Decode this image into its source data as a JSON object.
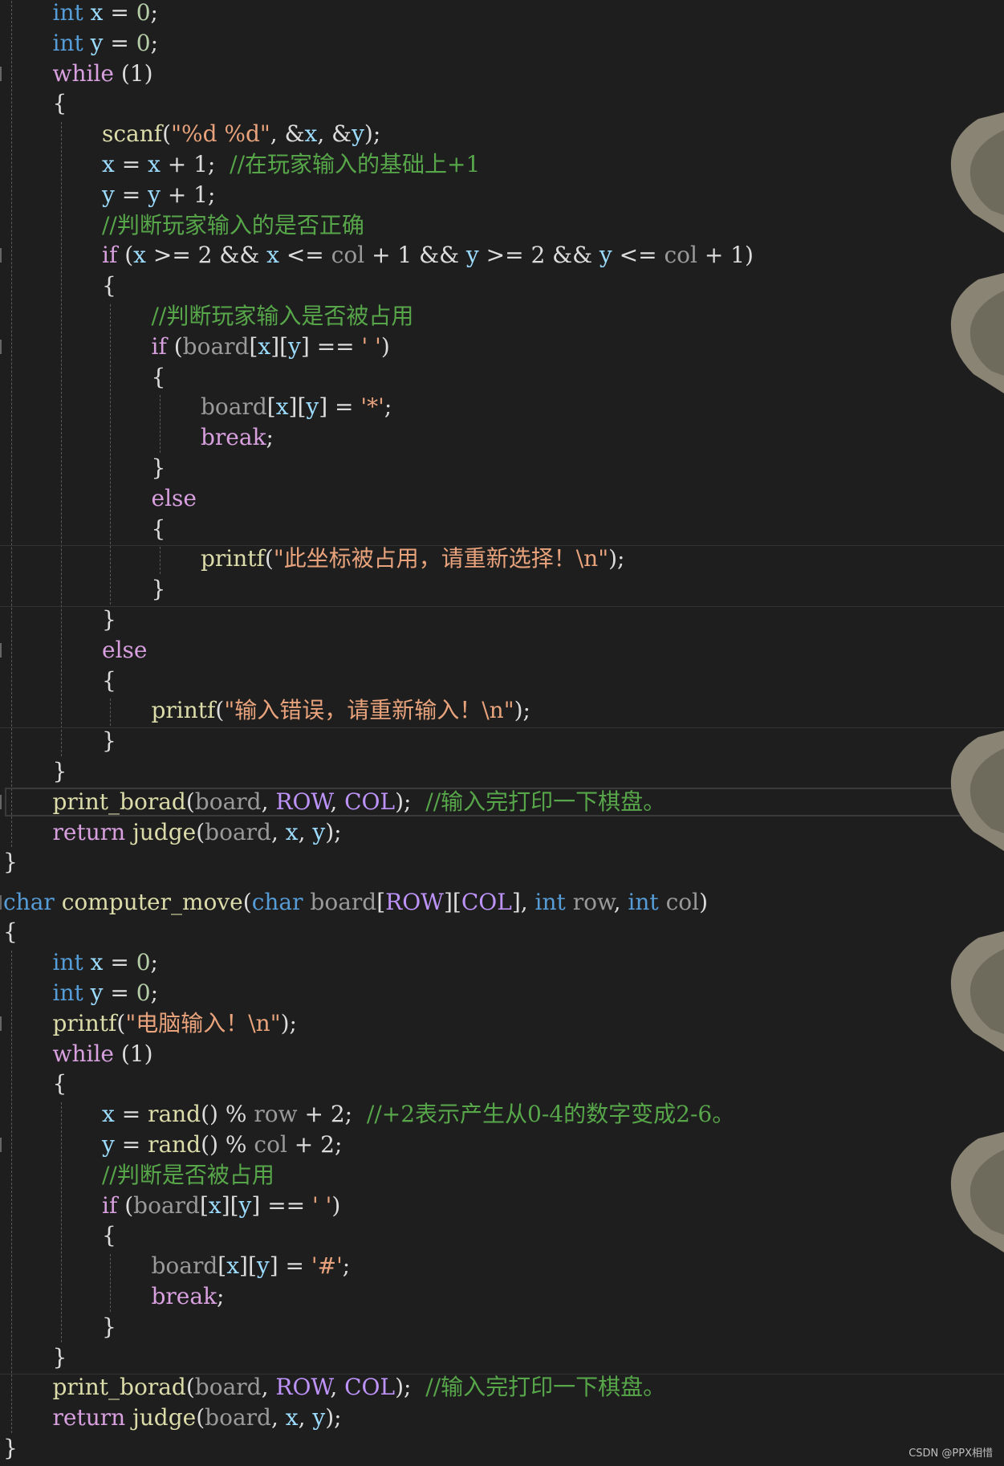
{
  "colors": {
    "background": "#1e1e1e",
    "keyword": "#569cd6",
    "control": "#d8a0df",
    "function": "#dcdcaa",
    "string": "#e8a37c",
    "comment": "#57a64a",
    "param": "#9a9a9a",
    "variable": "#9cdcfe",
    "macro": "#bd93f9",
    "text": "#dcdcdc"
  },
  "code": {
    "lines": [
      {
        "indent": 1,
        "tokens": [
          {
            "t": "int",
            "c": "keyword"
          },
          {
            "t": " "
          },
          {
            "t": "x",
            "c": "variable"
          },
          {
            "t": " = "
          },
          {
            "t": "0",
            "c": "number"
          },
          {
            "t": ";"
          }
        ]
      },
      {
        "indent": 1,
        "tokens": [
          {
            "t": "int",
            "c": "keyword"
          },
          {
            "t": " "
          },
          {
            "t": "y",
            "c": "variable"
          },
          {
            "t": " = "
          },
          {
            "t": "0",
            "c": "number"
          },
          {
            "t": ";"
          }
        ]
      },
      {
        "indent": 1,
        "tokens": [
          {
            "t": "while",
            "c": "control"
          },
          {
            "t": " (1)"
          }
        ]
      },
      {
        "indent": 1,
        "tokens": [
          {
            "t": "{"
          }
        ]
      },
      {
        "indent": 2,
        "tokens": [
          {
            "t": "scanf",
            "c": "function"
          },
          {
            "t": "("
          },
          {
            "t": "\"%d %d\"",
            "c": "string"
          },
          {
            "t": ", &"
          },
          {
            "t": "x",
            "c": "variable"
          },
          {
            "t": ", &"
          },
          {
            "t": "y",
            "c": "variable"
          },
          {
            "t": ");"
          }
        ]
      },
      {
        "indent": 2,
        "tokens": [
          {
            "t": "x",
            "c": "variable"
          },
          {
            "t": " = "
          },
          {
            "t": "x",
            "c": "variable"
          },
          {
            "t": " + 1;  "
          },
          {
            "t": "//在玩家输入的基础上+1",
            "c": "comment"
          }
        ]
      },
      {
        "indent": 2,
        "tokens": [
          {
            "t": "y",
            "c": "variable"
          },
          {
            "t": " = "
          },
          {
            "t": "y",
            "c": "variable"
          },
          {
            "t": " + 1;"
          }
        ]
      },
      {
        "indent": 2,
        "tokens": [
          {
            "t": "//判断玩家输入的是否正确",
            "c": "comment"
          }
        ]
      },
      {
        "indent": 2,
        "tokens": [
          {
            "t": "if",
            "c": "control"
          },
          {
            "t": " ("
          },
          {
            "t": "x",
            "c": "variable"
          },
          {
            "t": " >= 2 && "
          },
          {
            "t": "x",
            "c": "variable"
          },
          {
            "t": " <= "
          },
          {
            "t": "col",
            "c": "param"
          },
          {
            "t": " + 1 && "
          },
          {
            "t": "y",
            "c": "variable"
          },
          {
            "t": " >= 2 && "
          },
          {
            "t": "y",
            "c": "variable"
          },
          {
            "t": " <= "
          },
          {
            "t": "col",
            "c": "param"
          },
          {
            "t": " + 1)"
          }
        ]
      },
      {
        "indent": 2,
        "tokens": [
          {
            "t": "{"
          }
        ]
      },
      {
        "indent": 3,
        "tokens": [
          {
            "t": "//判断玩家输入是否被占用",
            "c": "comment"
          }
        ]
      },
      {
        "indent": 3,
        "tokens": [
          {
            "t": "if",
            "c": "control"
          },
          {
            "t": " ("
          },
          {
            "t": "board",
            "c": "param"
          },
          {
            "t": "["
          },
          {
            "t": "x",
            "c": "variable"
          },
          {
            "t": "]["
          },
          {
            "t": "y",
            "c": "variable"
          },
          {
            "t": "] == "
          },
          {
            "t": "' '",
            "c": "string"
          },
          {
            "t": ")"
          }
        ]
      },
      {
        "indent": 3,
        "tokens": [
          {
            "t": "{"
          }
        ]
      },
      {
        "indent": 4,
        "tokens": [
          {
            "t": "board",
            "c": "param"
          },
          {
            "t": "["
          },
          {
            "t": "x",
            "c": "variable"
          },
          {
            "t": "]["
          },
          {
            "t": "y",
            "c": "variable"
          },
          {
            "t": "] = "
          },
          {
            "t": "'*'",
            "c": "string"
          },
          {
            "t": ";"
          }
        ]
      },
      {
        "indent": 4,
        "tokens": [
          {
            "t": "break",
            "c": "control"
          },
          {
            "t": ";"
          }
        ]
      },
      {
        "indent": 3,
        "tokens": [
          {
            "t": "}"
          }
        ]
      },
      {
        "indent": 3,
        "tokens": [
          {
            "t": "else",
            "c": "control"
          }
        ]
      },
      {
        "indent": 3,
        "tokens": [
          {
            "t": "{"
          }
        ]
      },
      {
        "indent": 4,
        "tokens": [
          {
            "t": "printf",
            "c": "function"
          },
          {
            "t": "("
          },
          {
            "t": "\"此坐标被占用，请重新选择！\\n\"",
            "c": "string"
          },
          {
            "t": ");"
          }
        ]
      },
      {
        "indent": 3,
        "tokens": [
          {
            "t": "}"
          }
        ]
      },
      {
        "indent": 2,
        "tokens": [
          {
            "t": "}"
          }
        ]
      },
      {
        "indent": 2,
        "tokens": [
          {
            "t": "else",
            "c": "control"
          }
        ]
      },
      {
        "indent": 2,
        "tokens": [
          {
            "t": "{"
          }
        ]
      },
      {
        "indent": 3,
        "tokens": [
          {
            "t": "printf",
            "c": "function"
          },
          {
            "t": "("
          },
          {
            "t": "\"输入错误，请重新输入！\\n\"",
            "c": "string"
          },
          {
            "t": ");"
          }
        ]
      },
      {
        "indent": 2,
        "tokens": [
          {
            "t": "}"
          }
        ]
      },
      {
        "indent": 1,
        "tokens": [
          {
            "t": "}"
          }
        ]
      },
      {
        "indent": 1,
        "tokens": [
          {
            "t": "print_borad",
            "c": "function"
          },
          {
            "t": "("
          },
          {
            "t": "board",
            "c": "param"
          },
          {
            "t": ", "
          },
          {
            "t": "ROW",
            "c": "macro"
          },
          {
            "t": ", "
          },
          {
            "t": "COL",
            "c": "macro"
          },
          {
            "t": ");  "
          },
          {
            "t": "//输入完打印一下棋盘。",
            "c": "comment"
          }
        ]
      },
      {
        "indent": 1,
        "tokens": [
          {
            "t": "return",
            "c": "control"
          },
          {
            "t": " "
          },
          {
            "t": "judge",
            "c": "function"
          },
          {
            "t": "("
          },
          {
            "t": "board",
            "c": "param"
          },
          {
            "t": ", "
          },
          {
            "t": "x",
            "c": "variable"
          },
          {
            "t": ", "
          },
          {
            "t": "y",
            "c": "variable"
          },
          {
            "t": ");"
          }
        ]
      },
      {
        "indent": 0,
        "tokens": [
          {
            "t": "}"
          }
        ]
      },
      {
        "indent": 0,
        "tokens": [
          {
            "t": "char",
            "c": "keyword"
          },
          {
            "t": " "
          },
          {
            "t": "computer_move",
            "c": "function"
          },
          {
            "t": "("
          },
          {
            "t": "char",
            "c": "keyword"
          },
          {
            "t": " "
          },
          {
            "t": "board",
            "c": "param"
          },
          {
            "t": "["
          },
          {
            "t": "ROW",
            "c": "macro"
          },
          {
            "t": "]["
          },
          {
            "t": "COL",
            "c": "macro"
          },
          {
            "t": "], "
          },
          {
            "t": "int",
            "c": "keyword"
          },
          {
            "t": " "
          },
          {
            "t": "row",
            "c": "param"
          },
          {
            "t": ", "
          },
          {
            "t": "int",
            "c": "keyword"
          },
          {
            "t": " "
          },
          {
            "t": "col",
            "c": "param"
          },
          {
            "t": ")"
          }
        ]
      },
      {
        "indent": 0,
        "tokens": [
          {
            "t": "{"
          }
        ]
      },
      {
        "indent": 1,
        "tokens": [
          {
            "t": "int",
            "c": "keyword"
          },
          {
            "t": " "
          },
          {
            "t": "x",
            "c": "variable"
          },
          {
            "t": " = "
          },
          {
            "t": "0",
            "c": "number"
          },
          {
            "t": ";"
          }
        ]
      },
      {
        "indent": 1,
        "tokens": [
          {
            "t": "int",
            "c": "keyword"
          },
          {
            "t": " "
          },
          {
            "t": "y",
            "c": "variable"
          },
          {
            "t": " = "
          },
          {
            "t": "0",
            "c": "number"
          },
          {
            "t": ";"
          }
        ]
      },
      {
        "indent": 1,
        "tokens": [
          {
            "t": "printf",
            "c": "function"
          },
          {
            "t": "("
          },
          {
            "t": "\"电脑输入！\\n\"",
            "c": "string"
          },
          {
            "t": ");"
          }
        ]
      },
      {
        "indent": 1,
        "tokens": [
          {
            "t": "while",
            "c": "control"
          },
          {
            "t": " (1)"
          }
        ]
      },
      {
        "indent": 1,
        "tokens": [
          {
            "t": "{"
          }
        ]
      },
      {
        "indent": 2,
        "tokens": [
          {
            "t": "x",
            "c": "variable"
          },
          {
            "t": " = "
          },
          {
            "t": "rand",
            "c": "function"
          },
          {
            "t": "() % "
          },
          {
            "t": "row",
            "c": "param"
          },
          {
            "t": " + 2;  "
          },
          {
            "t": "//+2表示产生从0-4的数字变成2-6。",
            "c": "comment"
          }
        ]
      },
      {
        "indent": 2,
        "tokens": [
          {
            "t": "y",
            "c": "variable"
          },
          {
            "t": " = "
          },
          {
            "t": "rand",
            "c": "function"
          },
          {
            "t": "() % "
          },
          {
            "t": "col",
            "c": "param"
          },
          {
            "t": " + 2;"
          }
        ]
      },
      {
        "indent": 2,
        "tokens": [
          {
            "t": "//判断是否被占用",
            "c": "comment"
          }
        ]
      },
      {
        "indent": 2,
        "tokens": [
          {
            "t": "if",
            "c": "control"
          },
          {
            "t": " ("
          },
          {
            "t": "board",
            "c": "param"
          },
          {
            "t": "["
          },
          {
            "t": "x",
            "c": "variable"
          },
          {
            "t": "]["
          },
          {
            "t": "y",
            "c": "variable"
          },
          {
            "t": "] == "
          },
          {
            "t": "' '",
            "c": "string"
          },
          {
            "t": ")"
          }
        ]
      },
      {
        "indent": 2,
        "tokens": [
          {
            "t": "{"
          }
        ]
      },
      {
        "indent": 3,
        "tokens": [
          {
            "t": "board",
            "c": "param"
          },
          {
            "t": "["
          },
          {
            "t": "x",
            "c": "variable"
          },
          {
            "t": "]["
          },
          {
            "t": "y",
            "c": "variable"
          },
          {
            "t": "] = "
          },
          {
            "t": "'#'",
            "c": "string"
          },
          {
            "t": ";"
          }
        ]
      },
      {
        "indent": 3,
        "tokens": [
          {
            "t": "break",
            "c": "control"
          },
          {
            "t": ";"
          }
        ]
      },
      {
        "indent": 2,
        "tokens": [
          {
            "t": "}"
          }
        ]
      },
      {
        "indent": 1,
        "tokens": [
          {
            "t": "}"
          }
        ]
      },
      {
        "indent": 1,
        "tokens": [
          {
            "t": "print_borad",
            "c": "function"
          },
          {
            "t": "("
          },
          {
            "t": "board",
            "c": "param"
          },
          {
            "t": ", "
          },
          {
            "t": "ROW",
            "c": "macro"
          },
          {
            "t": ", "
          },
          {
            "t": "COL",
            "c": "macro"
          },
          {
            "t": ");  "
          },
          {
            "t": "//输入完打印一下棋盘。",
            "c": "comment"
          }
        ]
      },
      {
        "indent": 1,
        "tokens": [
          {
            "t": "return",
            "c": "control"
          },
          {
            "t": " "
          },
          {
            "t": "judge",
            "c": "function"
          },
          {
            "t": "("
          },
          {
            "t": "board",
            "c": "param"
          },
          {
            "t": ", "
          },
          {
            "t": "x",
            "c": "variable"
          },
          {
            "t": ", "
          },
          {
            "t": "y",
            "c": "variable"
          },
          {
            "t": ");"
          }
        ]
      },
      {
        "indent": 0,
        "tokens": [
          {
            "t": "}"
          }
        ]
      }
    ]
  },
  "watermark": "CSDN @PPX相惜"
}
